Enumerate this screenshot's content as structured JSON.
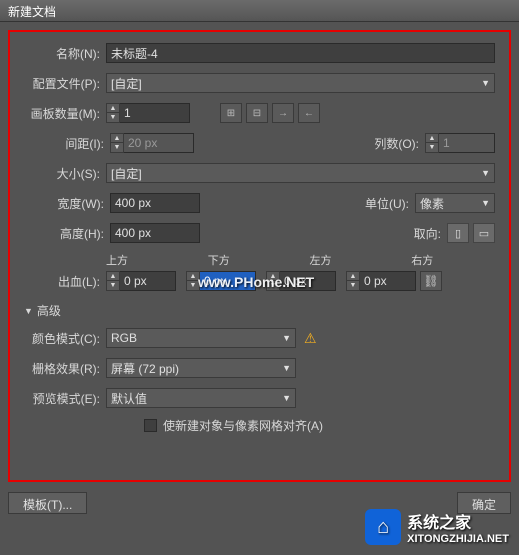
{
  "title": "新建文档",
  "fields": {
    "name_label": "名称(N):",
    "name_value": "未标题-4",
    "profile_label": "配置文件(P):",
    "profile_value": "[自定]",
    "artboard_label": "画板数量(M):",
    "artboard_value": "1",
    "spacing_label": "间距(I):",
    "spacing_value": "20 px",
    "cols_label": "列数(O):",
    "cols_value": "1",
    "size_label": "大小(S):",
    "size_value": "[自定]",
    "width_label": "宽度(W):",
    "width_value": "400 px",
    "unit_label": "单位(U):",
    "unit_value": "像素",
    "height_label": "高度(H):",
    "height_value": "400 px",
    "orient_label": "取向:",
    "bleed_label": "出血(L):",
    "bleed_top": "上方",
    "bleed_bottom": "下方",
    "bleed_left": "左方",
    "bleed_right": "右方",
    "bleed_val_top": "0 px",
    "bleed_val_bottom": "0 px",
    "bleed_val_left": "0 px",
    "bleed_val_right": "0 px"
  },
  "advanced": {
    "header": "高级",
    "colormode_label": "颜色模式(C):",
    "colormode_value": "RGB",
    "raster_label": "栅格效果(R):",
    "raster_value": "屏幕 (72 ppi)",
    "preview_label": "预览模式(E):",
    "preview_value": "默认值",
    "align_label": "使新建对象与像素网格对齐(A)"
  },
  "buttons": {
    "template": "模板(T)...",
    "ok": "确定"
  },
  "watermark1": "www.PHome.NET",
  "watermark2_big": "系统之家",
  "watermark2_small": "XITONGZHIJIA.NET"
}
